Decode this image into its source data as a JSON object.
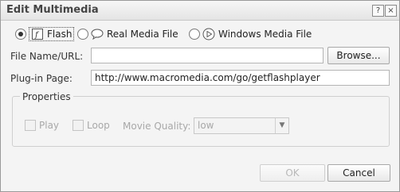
{
  "title": "Edit Multimedia",
  "titlebar": {
    "help": "?",
    "close": "×"
  },
  "media_types": [
    {
      "label": "Flash",
      "selected": true,
      "icon": "flash-icon"
    },
    {
      "label": "Real Media File",
      "selected": false,
      "icon": "real-media-icon"
    },
    {
      "label": "Windows Media File",
      "selected": false,
      "icon": "windows-media-icon"
    }
  ],
  "file": {
    "label": "File Name/URL:",
    "value": "",
    "browse_label": "Browse..."
  },
  "plugin": {
    "label": "Plug-in Page:",
    "value": "http://www.macromedia.com/go/getflashplayer"
  },
  "properties": {
    "legend": "Properties",
    "play_label": "Play",
    "loop_label": "Loop",
    "quality_label": "Movie Quality:",
    "quality_value": "low"
  },
  "buttons": {
    "ok": "OK",
    "cancel": "Cancel"
  }
}
